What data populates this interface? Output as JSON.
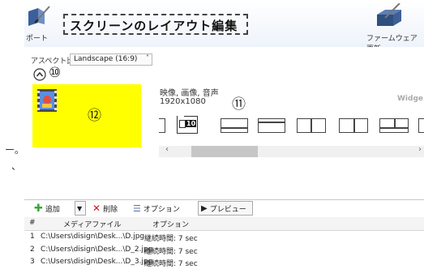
{
  "page_fragments": {
    "line1": "ー。",
    "line2": "、"
  },
  "header": {
    "left_button_label": "ポート",
    "title": "スクリーンのレイアウト編集",
    "right_button_label": "ファームウェア更新"
  },
  "aspect": {
    "label": "アスペクト比",
    "selected": "Landscape (16:9)"
  },
  "callouts": {
    "c10": "⑩",
    "c11": "⑪",
    "c12": "⑫"
  },
  "layout_info": {
    "media_type": "映像, 画像, 音声",
    "resolution": "1920x1080",
    "widget_label": "Widge"
  },
  "layout_thumbnail": {
    "label": "10"
  },
  "toolbar": {
    "add": "追加",
    "delete": "削除",
    "options": "オプション",
    "preview": "プレビュー"
  },
  "table": {
    "columns": [
      "#",
      "メディアファイル",
      "オプション"
    ],
    "rows": [
      {
        "num": "1",
        "file": "C:\\Users\\disign\\Desk...\\D.jpg",
        "option": "継続時間: 7 sec"
      },
      {
        "num": "2",
        "file": "C:\\Users\\disign\\Desk...\\D_2.jpg",
        "option": "継続時間: 7 sec"
      },
      {
        "num": "3",
        "file": "C:\\Users\\disign\\Desk...\\D_3.jpg",
        "option": "継続時間: 7 sec"
      }
    ]
  },
  "colors": {
    "accent": "#ffff00",
    "header_bg": "#eef3fb",
    "delete_red": "#d0161b",
    "add_green": "#3aa63a"
  }
}
